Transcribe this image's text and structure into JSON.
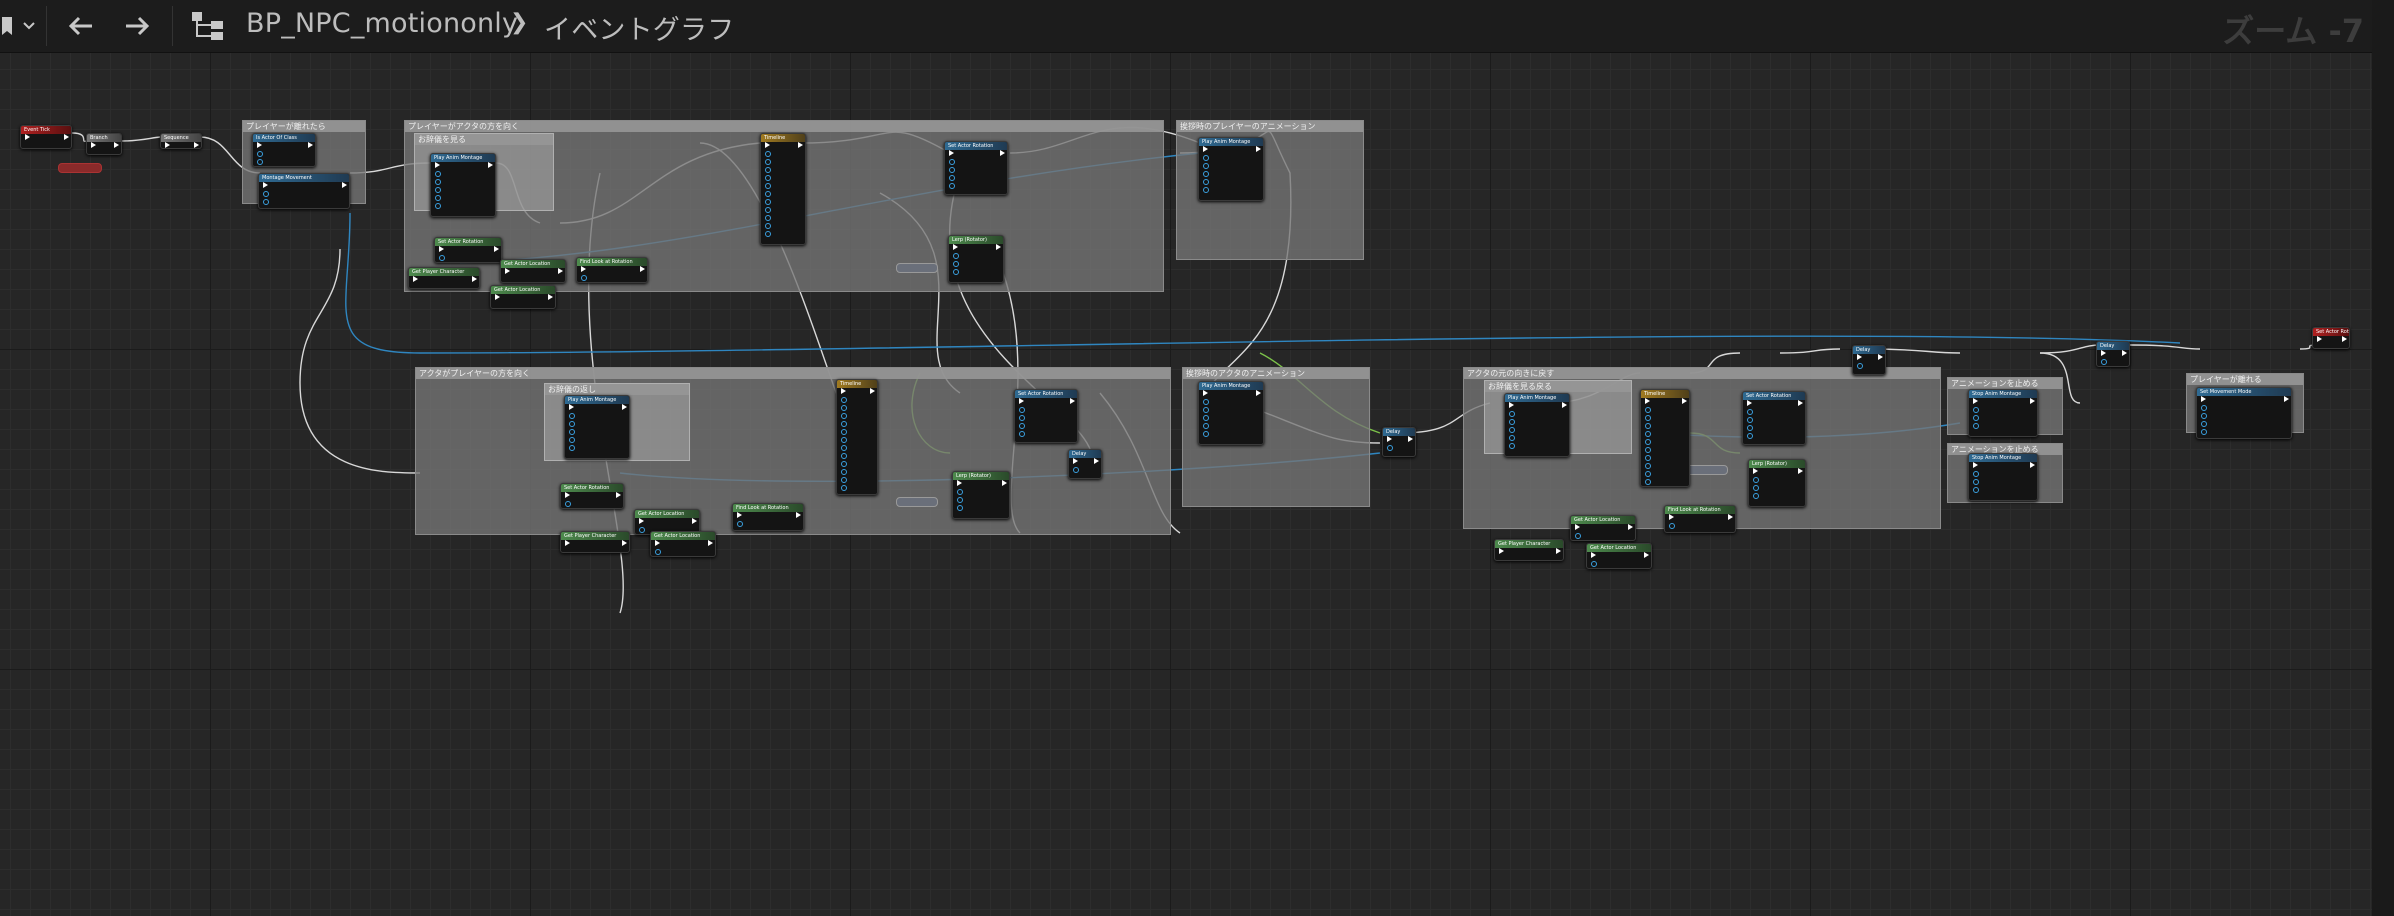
{
  "toolbar": {
    "bookmark_icon": "bookmark-icon",
    "dropdown_icon": "chevron-down-icon",
    "back_icon": "arrow-left-icon",
    "forward_icon": "arrow-right-icon",
    "graph_icon": "graph-hierarchy-icon",
    "blueprint_name": "BP_NPC_motiononly",
    "separator": "❯",
    "graph_name": "イベントグラフ",
    "zoom_label": "ズーム -7"
  },
  "colors": {
    "exec_wire": "#d8d8d8",
    "data_wire": "#2f86c0",
    "float_wire": "#7cc24a",
    "comment_box": "#767676",
    "node_body": "#141414"
  },
  "comments": [
    {
      "title": "プレイヤーが離れたら"
    },
    {
      "title": "プレイヤーがアクタの方を向く"
    },
    {
      "title": "お辞儀を見る"
    },
    {
      "title": "挨拶時のプレイヤーのアニメーション"
    },
    {
      "title": "アクタがプレイヤーの方を向く"
    },
    {
      "title": "お辞儀の返し"
    },
    {
      "title": "挨拶時のアクタのアニメーション"
    },
    {
      "title": "アクタの元の向きに戻す"
    },
    {
      "title": "お辞儀を見る戻る"
    },
    {
      "title": "アニメーションを止める"
    },
    {
      "title": "アニメーションを止める"
    },
    {
      "title": "プレイヤーが離れる"
    }
  ],
  "nodes": [
    {
      "title": "Event Tick",
      "kind": "red"
    },
    {
      "title": "Branch",
      "kind": "gray"
    },
    {
      "title": "Sequence",
      "kind": "gray"
    },
    {
      "title": "Is Actor Of Class",
      "kind": "blue"
    },
    {
      "title": "Montage Movement",
      "kind": "blue"
    },
    {
      "title": "Play Anim Montage",
      "kind": "blue"
    },
    {
      "title": "Set Actor Rotation",
      "kind": "green"
    },
    {
      "title": "Get Actor Location",
      "kind": "green"
    },
    {
      "title": "Get Player Character",
      "kind": "green"
    },
    {
      "title": "Get Actor Location",
      "kind": "green"
    },
    {
      "title": "Find Look at Rotation",
      "kind": "green"
    },
    {
      "title": "Timeline",
      "kind": "gold"
    },
    {
      "title": "Set Actor Rotation",
      "kind": "blue"
    },
    {
      "title": "Lerp (Rotator)",
      "kind": "green"
    },
    {
      "title": "Play Anim Montage",
      "kind": "blue"
    },
    {
      "title": "Play Anim Montage",
      "kind": "blue"
    },
    {
      "title": "Set Actor Rotation",
      "kind": "green"
    },
    {
      "title": "Get Actor Location",
      "kind": "green"
    },
    {
      "title": "Get Player Character",
      "kind": "green"
    },
    {
      "title": "Get Actor Location",
      "kind": "green"
    },
    {
      "title": "Find Look at Rotation",
      "kind": "green"
    },
    {
      "title": "Timeline",
      "kind": "gold"
    },
    {
      "title": "Set Actor Rotation",
      "kind": "blue"
    },
    {
      "title": "Delay",
      "kind": "blue"
    },
    {
      "title": "Lerp (Rotator)",
      "kind": "green"
    },
    {
      "title": "Play Anim Montage",
      "kind": "blue"
    },
    {
      "title": "Delay",
      "kind": "blue"
    },
    {
      "title": "Play Anim Montage",
      "kind": "blue"
    },
    {
      "title": "Timeline",
      "kind": "gold"
    },
    {
      "title": "Set Actor Rotation",
      "kind": "blue"
    },
    {
      "title": "Delay",
      "kind": "blue"
    },
    {
      "title": "Lerp (Rotator)",
      "kind": "green"
    },
    {
      "title": "Find Look at Rotation",
      "kind": "green"
    },
    {
      "title": "Get Actor Location",
      "kind": "green"
    },
    {
      "title": "Get Player Character",
      "kind": "green"
    },
    {
      "title": "Get Actor Location",
      "kind": "green"
    },
    {
      "title": "Stop Anim Montage",
      "kind": "blue"
    },
    {
      "title": "Stop Anim Montage",
      "kind": "blue"
    },
    {
      "title": "Delay",
      "kind": "blue"
    },
    {
      "title": "Set Movement Mode",
      "kind": "blue"
    },
    {
      "title": "Set Actor Rotation",
      "kind": "red"
    }
  ]
}
